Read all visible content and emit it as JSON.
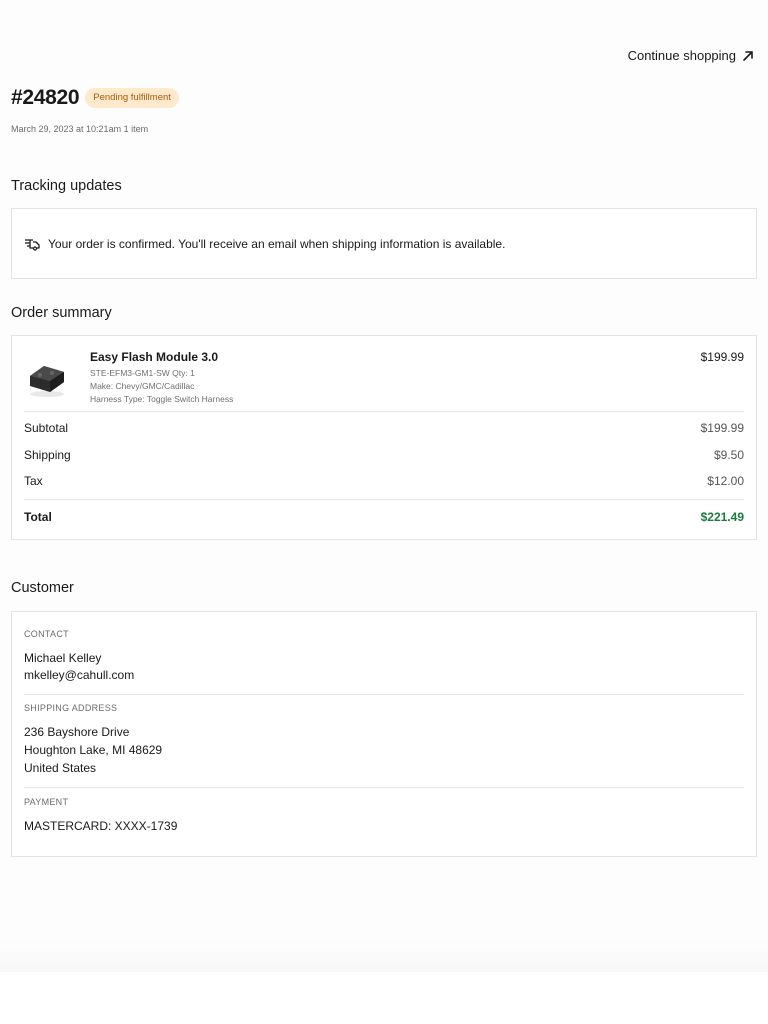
{
  "header": {
    "continue_label": "Continue shopping"
  },
  "order": {
    "number": "#24820",
    "status": "Pending fulfillment",
    "meta": "March 29, 2023 at 10:21am 1 item"
  },
  "tracking": {
    "title": "Tracking updates",
    "message": "Your order is confirmed. You'll receive an email when shipping information is available."
  },
  "summary": {
    "title": "Order summary",
    "item": {
      "name": "Easy Flash Module 3.0",
      "sku_qty": "STE-EFM3-GM1-SW Qty: 1",
      "make": "Make: Chevy/GMC/Cadillac",
      "harness": "Harness Type: Toggle Switch Harness",
      "price": "$199.99"
    },
    "subtotal_label": "Subtotal",
    "subtotal": "$199.99",
    "shipping_label": "Shipping",
    "shipping": "$9.50",
    "tax_label": "Tax",
    "tax": "$12.00",
    "total_label": "Total",
    "total": "$221.49"
  },
  "customer": {
    "title": "Customer",
    "contact_label": "CONTACT",
    "name": "Michael Kelley",
    "email": "mkelley@cahull.com",
    "shipping_label": "SHIPPING ADDRESS",
    "address_line1": "236 Bayshore Drive",
    "address_line2": "Houghton Lake, MI 48629",
    "address_country": "United States",
    "payment_label": "PAYMENT",
    "payment": "MASTERCARD: XXXX-1739"
  },
  "colors": {
    "badge_bg": "#ffe9cc",
    "badge_text": "#a35a0b",
    "total": "#1c7a3e"
  },
  "icons": {
    "continue": "arrow-up-right-icon",
    "tracking": "delivery-truck-icon",
    "product": "product-thumbnail"
  }
}
